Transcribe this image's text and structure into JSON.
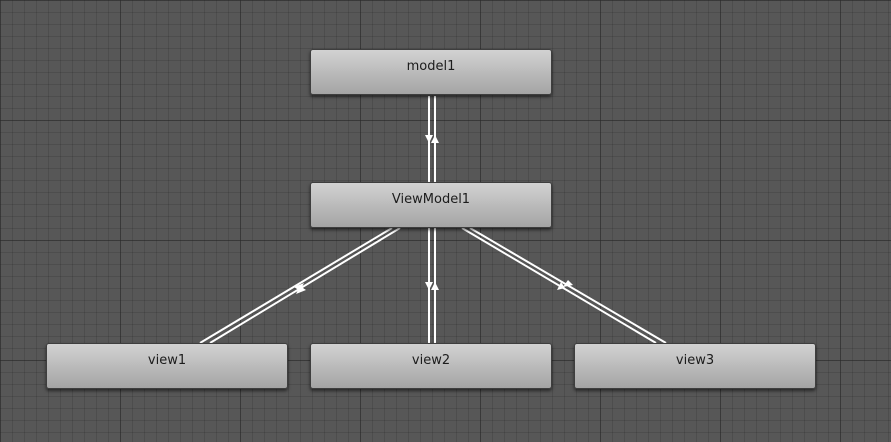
{
  "diagram": {
    "nodes": [
      {
        "id": "model1",
        "label": "model1"
      },
      {
        "id": "viewmodel1",
        "label": "ViewModel1"
      },
      {
        "id": "view1",
        "label": "view1"
      },
      {
        "id": "view2",
        "label": "view2"
      },
      {
        "id": "view3",
        "label": "view3"
      }
    ],
    "edges": [
      {
        "from": "model1",
        "to": "viewmodel1",
        "bidirectional": true
      },
      {
        "from": "viewmodel1",
        "to": "view1",
        "bidirectional": true
      },
      {
        "from": "viewmodel1",
        "to": "view2",
        "bidirectional": true
      },
      {
        "from": "viewmodel1",
        "to": "view3",
        "bidirectional": true
      }
    ],
    "colors": {
      "background": "#575757",
      "node_fill": "#bcbcbc",
      "edge": "#ffffff"
    }
  }
}
